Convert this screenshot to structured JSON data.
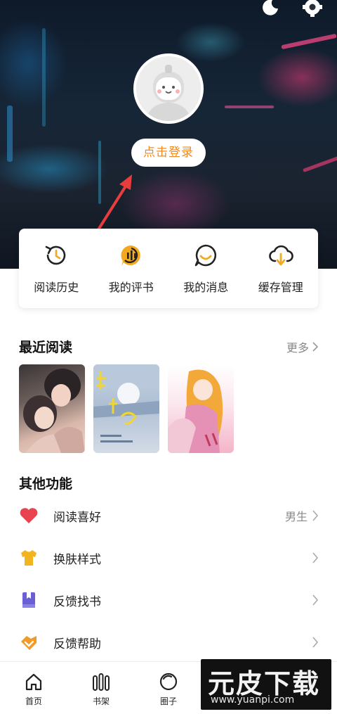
{
  "profile": {
    "login_label": "点击登录"
  },
  "quick_actions": [
    {
      "label": "阅读历史",
      "icon": "history-icon"
    },
    {
      "label": "我的评书",
      "icon": "comment-icon"
    },
    {
      "label": "我的消息",
      "icon": "message-icon"
    },
    {
      "label": "缓存管理",
      "icon": "cloud-download-icon"
    }
  ],
  "recent": {
    "title": "最近阅读",
    "more_label": "更多"
  },
  "other": {
    "title": "其他功能",
    "items": [
      {
        "label": "阅读喜好",
        "value": "男生",
        "icon": "heart-icon"
      },
      {
        "label": "换肤样式",
        "value": "",
        "icon": "shirt-icon"
      },
      {
        "label": "反馈找书",
        "value": "",
        "icon": "book-icon"
      },
      {
        "label": "反馈帮助",
        "value": "",
        "icon": "help-icon"
      }
    ]
  },
  "nav": [
    {
      "label": "首页",
      "icon": "home-icon"
    },
    {
      "label": "书架",
      "icon": "bookshelf-icon"
    },
    {
      "label": "圈子",
      "icon": "circle-icon"
    }
  ],
  "watermark": {
    "name": "元皮下载",
    "url": "www.yuanpi.com"
  },
  "colors": {
    "accent": "#f08a1c",
    "heart": "#e8434e",
    "shirt": "#f2b51f",
    "book": "#6b5fd6",
    "help": "#f09a27"
  }
}
